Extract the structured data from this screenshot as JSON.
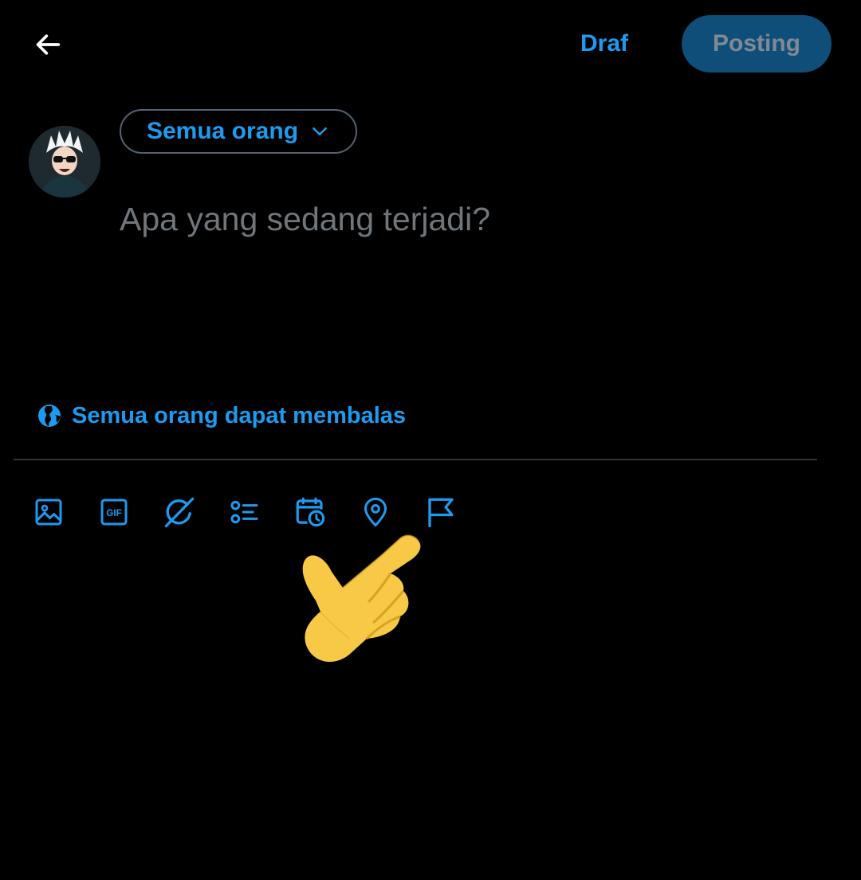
{
  "header": {
    "back_icon": "arrow-left-icon",
    "draft_label": "Draf",
    "post_label": "Posting"
  },
  "composer": {
    "audience_label": "Semua orang",
    "audience_icon": "chevron-down-icon",
    "placeholder": "Apa yang sedang terjadi?",
    "reply_setting_label": "Semua orang dapat membalas",
    "reply_setting_icon": "globe-icon"
  },
  "toolbar": {
    "items": [
      {
        "icon": "image-icon"
      },
      {
        "icon": "gif-icon",
        "text": "GIF"
      },
      {
        "icon": "grok-icon"
      },
      {
        "icon": "poll-icon"
      },
      {
        "icon": "schedule-icon"
      },
      {
        "icon": "location-icon"
      },
      {
        "icon": "flag-icon"
      }
    ]
  },
  "colors": {
    "background": "#000000",
    "accent": "#1d9bf0",
    "post_button_bg": "#0f4e78",
    "post_button_text": "#7f8a93",
    "placeholder": "#71767b",
    "divider": "#2f3336"
  }
}
